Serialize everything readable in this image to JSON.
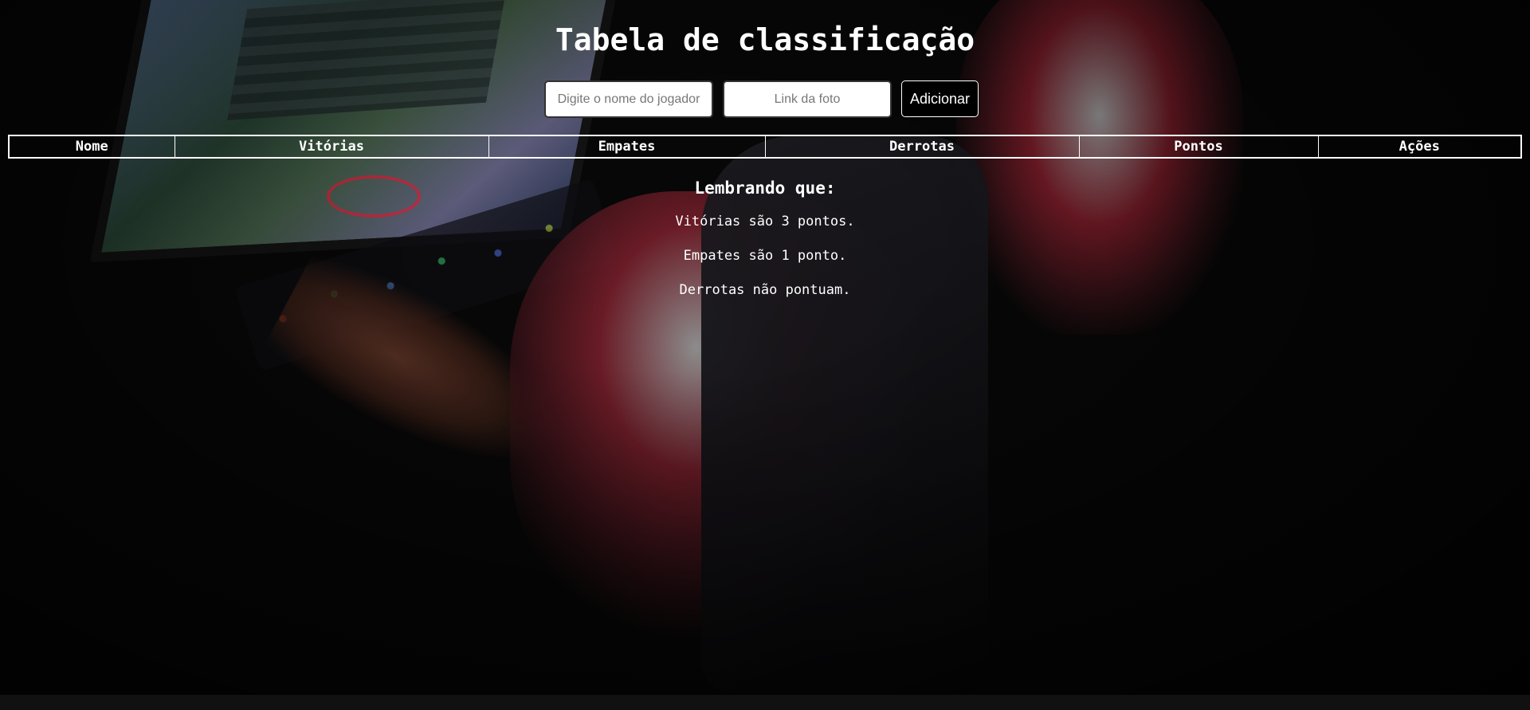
{
  "header": {
    "title": "Tabela de classificação"
  },
  "form": {
    "player_name_placeholder": "Digite o nome do jogador",
    "photo_link_placeholder": "Link da foto",
    "add_button_label": "Adicionar"
  },
  "table": {
    "columns": [
      "Nome",
      "Vitórias",
      "Empates",
      "Derrotas",
      "Pontos",
      "Ações"
    ],
    "rows": []
  },
  "reminder": {
    "heading": "Lembrando que:",
    "rules": [
      "Vitórias são 3 pontos.",
      "Empates são 1 ponto.",
      "Derrotas não pontuam."
    ]
  }
}
